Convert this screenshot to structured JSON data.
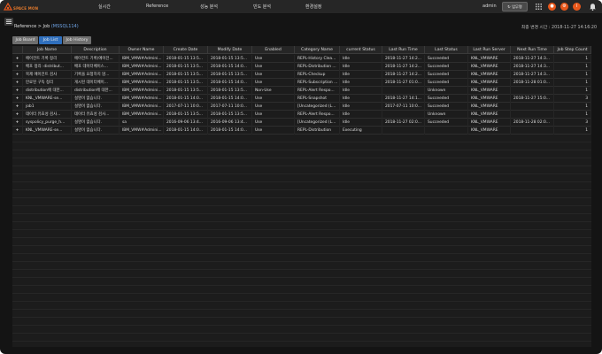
{
  "header": {
    "logo_text": "SPACE MON",
    "menu": [
      "실시간",
      "Reference",
      "성능 분석",
      "빈도 분석",
      "환경설정"
    ],
    "user": "admin",
    "update_button": "업무명",
    "icon_buttons": [
      "user-icon",
      "settings-icon",
      "info-icon",
      "bell-icon"
    ],
    "accent_color": "#e8571a"
  },
  "breadcrumb": {
    "prefix": "Reference > Job",
    "instance": "(MSSQL114)"
  },
  "last_changed": "최종 변경 시간 : 2018-11-27 14:16:20",
  "tabs": [
    {
      "label": "Job Board",
      "active": false
    },
    {
      "label": "Job List",
      "active": true
    },
    {
      "label": "Job History",
      "active": false
    }
  ],
  "table": {
    "columns": [
      "",
      "Job Name",
      "Description",
      "Owner Name",
      "Create Date",
      "Modify Date",
      "Enabled",
      "Category Name",
      "current Status",
      "Last Run Time",
      "Last Status",
      "Last Run Server",
      "Next Run Time",
      "Job Step Count"
    ],
    "rows": [
      [
        "+",
        "에이전트 기록 정리",
        "에이전트 기록(에이전...",
        "IBM_VMW#Admini...",
        "2018-01-15 13:5...",
        "2018-01-15 13:5...",
        "Use",
        "REPL-History Clea...",
        "Idle",
        "2018-11-27 14:2...",
        "Succeeded",
        "KNL_VMWARE",
        "2018-11-27 14:3...",
        "1"
      ],
      [
        "+",
        "배포 정리: distribut...",
        "배포 데이터베이스...",
        "IBM_VMW#Admini...",
        "2018-01-15 13:5...",
        "2018-01-15 14:0...",
        "Use",
        "REPL-Distribution ...",
        "Idle",
        "2018-11-27 14:2...",
        "Succeeded",
        "KNL_VMWARE",
        "2018-11-27 14:3...",
        "1"
      ],
      [
        "+",
        "복제 에이전트 검사",
        "기록을 요청하지 않...",
        "IBM_VMW#Admini...",
        "2018-01-15 13:5...",
        "2018-01-15 13:5...",
        "Use",
        "REPL-Checkup",
        "Idle",
        "2018-11-27 14:2...",
        "Succeeded",
        "KNL_VMWARE",
        "2018-11-27 14:3...",
        "1"
      ],
      [
        "+",
        "만료된 구독 정리",
        "게시된 데이터베이...",
        "IBM_VMW#Admini...",
        "2018-01-15 13:5...",
        "2018-01-15 14:0...",
        "Use",
        "REPL-Subscription ...",
        "Idle",
        "2018-11-27 01:0...",
        "Succeeded",
        "KNL_VMWARE",
        "2018-11-28 01:0...",
        "1"
      ],
      [
        "+",
        "distribution에 대한...",
        "distribution에 대한...",
        "IBM_VMW#Admini...",
        "2018-01-15 13:5...",
        "2018-01-15 13:5...",
        "Non-Use",
        "REPL-Alert Respo...",
        "Idle",
        "",
        "Unknown",
        "KNL_VMWARE",
        "",
        "1"
      ],
      [
        "+",
        "KNL_VMWARE-se...",
        "설명이 없습니다.",
        "IBM_VMW#Admini...",
        "2018-01-15 14:0...",
        "2018-01-15 14:0...",
        "Use",
        "REPL-Snapshot",
        "Idle",
        "2018-11-27 14:1...",
        "Succeeded",
        "KNL_VMWARE",
        "2018-11-27 15:0...",
        "3"
      ],
      [
        "+",
        "job1",
        "설명이 없습니다.",
        "IBM_VMW#Admini...",
        "2017-07-11 10:0...",
        "2017-07-11 10:0...",
        "Use",
        "[Uncategorized (L...",
        "Idle",
        "2017-07-11 10:0...",
        "Succeeded",
        "KNL_VMWARE",
        "",
        "1"
      ],
      [
        "+",
        "데이터 유효성 검사...",
        "데이터 유효성 검사...",
        "IBM_VMW#Admini...",
        "2018-01-15 13:5...",
        "2018-01-15 13:5...",
        "Use",
        "REPL-Alert Respo...",
        "Idle",
        "",
        "Unknown",
        "KNL_VMWARE",
        "",
        "1"
      ],
      [
        "+",
        "syspolicy_purge_h...",
        "설명이 없습니다.",
        "sa",
        "2016-09-06 13:4...",
        "2016-09-06 13:4...",
        "Use",
        "[Uncategorized (L...",
        "Idle",
        "2018-11-27 02:0...",
        "Succeeded",
        "KNL_VMWARE",
        "2018-11-28 02:0...",
        "3"
      ],
      [
        "+",
        "KNL_VMWARE-se...",
        "설명이 없습니다.",
        "IBM_VMW#Admini...",
        "2018-01-15 14:0...",
        "2018-01-15 14:0...",
        "Use",
        "REPL-Distribution",
        "Executing",
        "",
        "",
        "KNL_VMWARE",
        "",
        "1"
      ]
    ]
  }
}
